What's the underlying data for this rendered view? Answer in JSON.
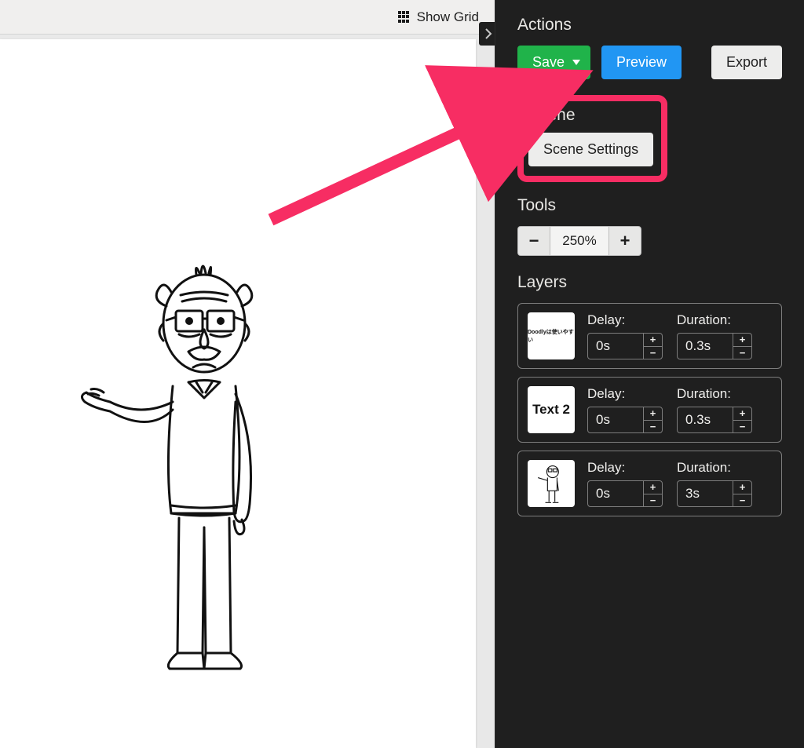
{
  "topbar": {
    "show_grid_label": "Show Grid",
    "collapse_aria": "collapse panel"
  },
  "panel": {
    "actions_title": "Actions",
    "save_label": "Save",
    "preview_label": "Preview",
    "export_label": "Export",
    "scene_title": "Scene",
    "scene_settings_label": "Scene Settings",
    "tools_title": "Tools",
    "zoom_minus": "−",
    "zoom_value": "250%",
    "zoom_plus": "+",
    "layers_title": "Layers"
  },
  "layers": [
    {
      "thumb_text": "Doodlyは使いやすい",
      "thumb_class": "small-text",
      "delay_label": "Delay:",
      "delay_value": "0s",
      "duration_label": "Duration:",
      "duration_value": "0.3s"
    },
    {
      "thumb_text": "Text 2",
      "thumb_class": "text2",
      "delay_label": "Delay:",
      "delay_value": "0s",
      "duration_label": "Duration:",
      "duration_value": "0.3s"
    },
    {
      "thumb_text": "",
      "thumb_class": "oldman-icon",
      "delay_label": "Delay:",
      "delay_value": "0s",
      "duration_label": "Duration:",
      "duration_value": "3s"
    }
  ],
  "steppers": {
    "plus": "+",
    "minus": "−"
  }
}
